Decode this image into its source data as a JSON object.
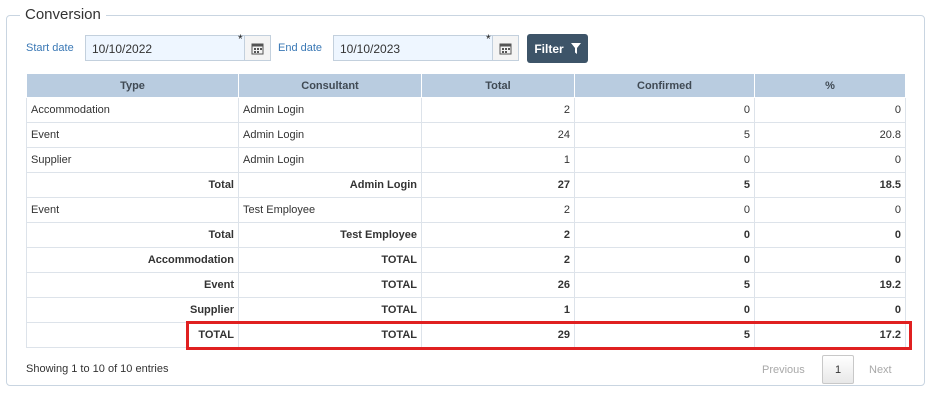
{
  "section_title": "Conversion",
  "filters": {
    "start_label": "Start date",
    "start_value": "10/10/2022",
    "end_label": "End date",
    "end_value": "10/10/2023",
    "required_mark": "*",
    "filter_label": "Filter"
  },
  "table": {
    "headers": [
      "Type",
      "Consultant",
      "Total",
      "Confirmed",
      "%"
    ],
    "rows": [
      {
        "type": "Accommodation",
        "consultant": "Admin Login",
        "total": "2",
        "confirmed": "0",
        "pct": "0"
      },
      {
        "type": "Event",
        "consultant": "Admin Login",
        "total": "24",
        "confirmed": "5",
        "pct": "20.8"
      },
      {
        "type": "Supplier",
        "consultant": "Admin Login",
        "total": "1",
        "confirmed": "0",
        "pct": "0"
      },
      {
        "type": "Total",
        "consultant": "Admin Login",
        "total": "27",
        "confirmed": "5",
        "pct": "18.5"
      },
      {
        "type": "Event",
        "consultant": "Test Employee",
        "total": "2",
        "confirmed": "0",
        "pct": "0"
      },
      {
        "type": "Total",
        "consultant": "Test Employee",
        "total": "2",
        "confirmed": "0",
        "pct": "0"
      },
      {
        "type": "Accommodation",
        "consultant": "TOTAL",
        "total": "2",
        "confirmed": "0",
        "pct": "0"
      },
      {
        "type": "Event",
        "consultant": "TOTAL",
        "total": "26",
        "confirmed": "5",
        "pct": "19.2"
      },
      {
        "type": "Supplier",
        "consultant": "TOTAL",
        "total": "1",
        "confirmed": "0",
        "pct": "0"
      },
      {
        "type": "TOTAL",
        "consultant": "TOTAL",
        "total": "29",
        "confirmed": "5",
        "pct": "17.2"
      }
    ]
  },
  "footer": {
    "info": "Showing 1 to 10 of 10 entries",
    "previous": "Previous",
    "current_page": "1",
    "next": "Next"
  },
  "colors": {
    "header_bg": "#b9cce0",
    "filter_button": "#3d5468",
    "highlight": "#e02020",
    "label_blue": "#3a78b5"
  }
}
